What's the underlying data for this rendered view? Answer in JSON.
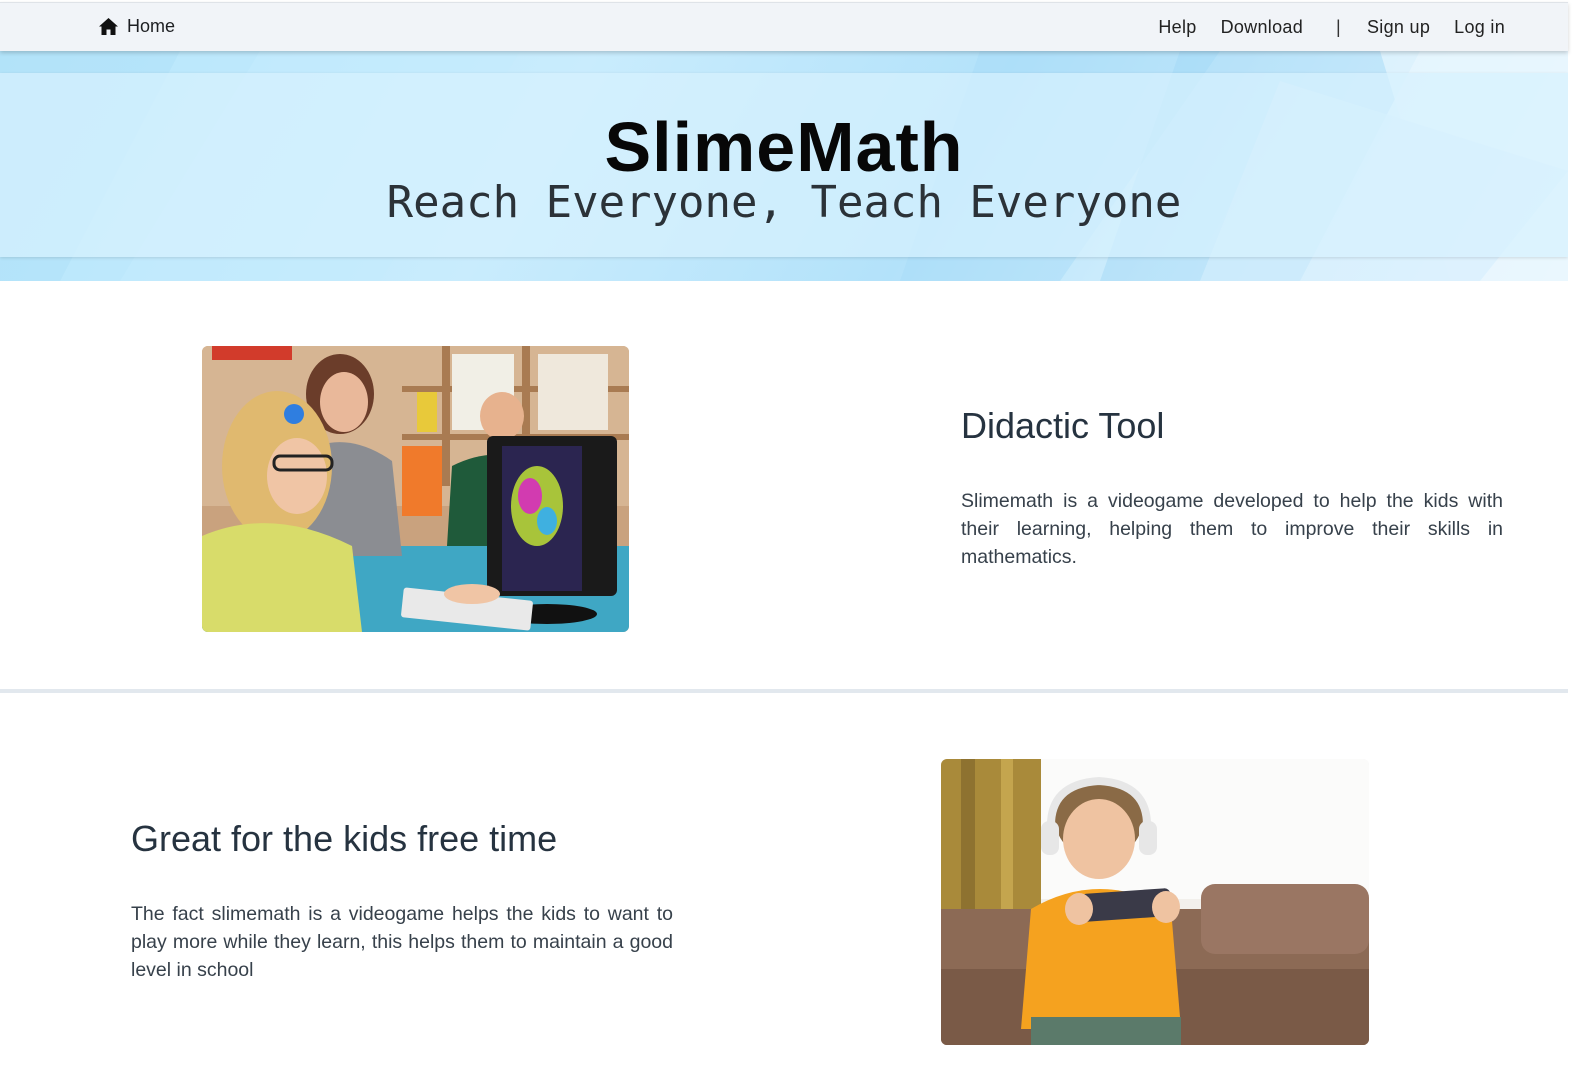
{
  "nav": {
    "home_label": "Home",
    "links": {
      "help": "Help",
      "download": "Download",
      "separator": "|",
      "signup": "Sign up",
      "login": "Log in"
    }
  },
  "hero": {
    "title": "SlimeMath",
    "subtitle": "Reach Everyone, Teach Everyone"
  },
  "sections": [
    {
      "title": "Didactic Tool",
      "text": "Slimemath is a videogame developed to help the kids with their learning, helping them to improve their skills in mathematics.",
      "image": "classroom-photo"
    },
    {
      "title": "Great for the kids free time",
      "text": "The fact slimemath is a videogame helps the kids to want to play more while they learn, this helps them to maintain a good level in school",
      "image": "kid-with-phone-photo"
    }
  ],
  "icons": {
    "home": "home-icon"
  },
  "colors": {
    "navbar_bg": "#f1f4f8",
    "hero_bg": "#c9ecfd",
    "heading_text": "#263340",
    "body_text": "#37414b"
  }
}
